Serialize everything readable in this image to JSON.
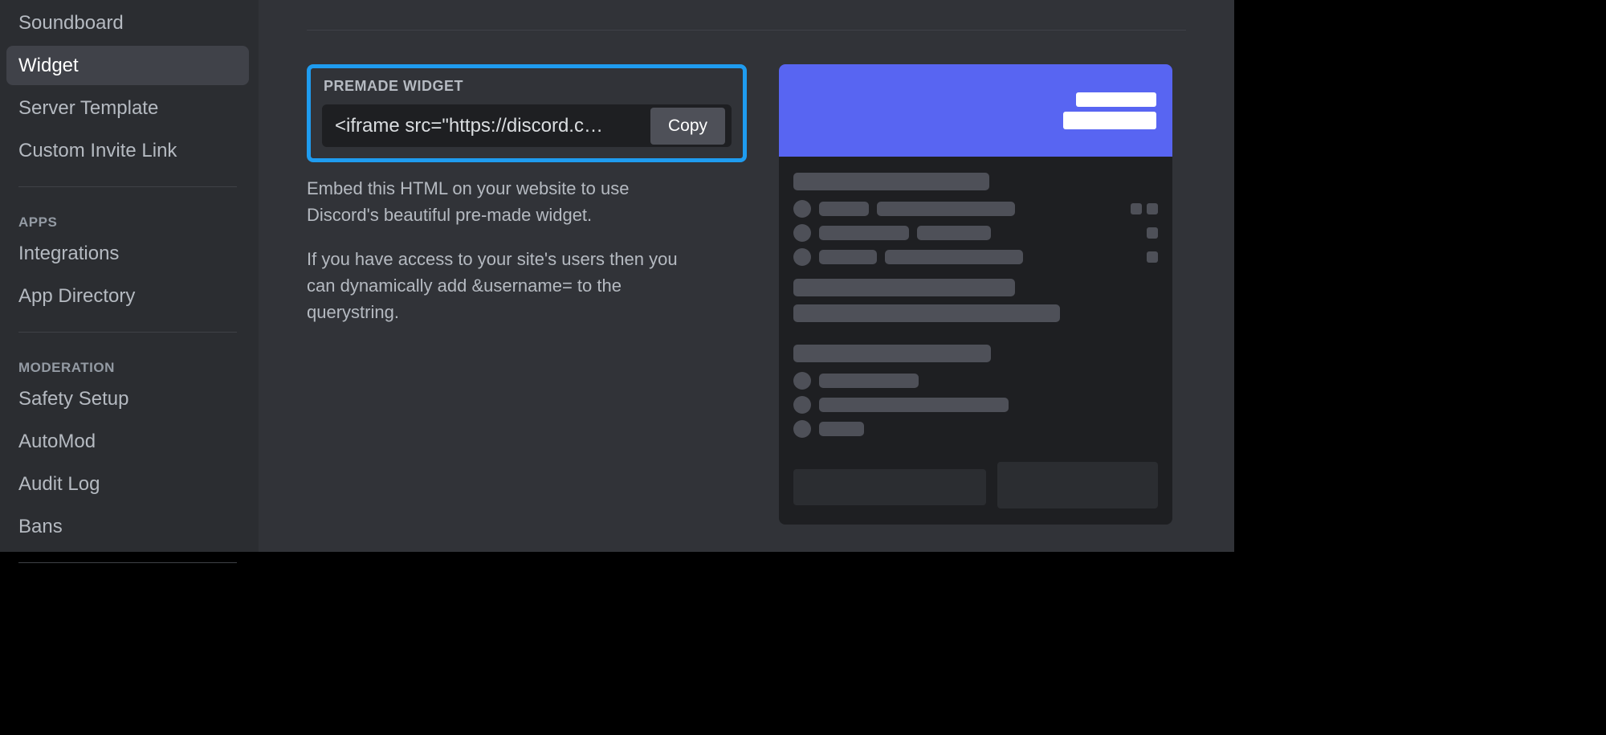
{
  "sidebar": {
    "items_top": [
      {
        "label": "Soundboard"
      },
      {
        "label": "Widget"
      },
      {
        "label": "Server Template"
      },
      {
        "label": "Custom Invite Link"
      }
    ],
    "active_index": 1,
    "section_apps": "APPS",
    "items_apps": [
      {
        "label": "Integrations"
      },
      {
        "label": "App Directory"
      }
    ],
    "section_mod": "MODERATION",
    "items_mod": [
      {
        "label": "Safety Setup"
      },
      {
        "label": "AutoMod"
      },
      {
        "label": "Audit Log"
      },
      {
        "label": "Bans"
      }
    ]
  },
  "premade": {
    "title": "PREMADE WIDGET",
    "code": "<iframe src=\"https://discord.c…",
    "copy_label": "Copy",
    "desc1": "Embed this HTML on your website to use Discord's beautiful pre-made widget.",
    "desc2": "If you have access to your site's users then you can dynamically add &username= to the querystring."
  }
}
